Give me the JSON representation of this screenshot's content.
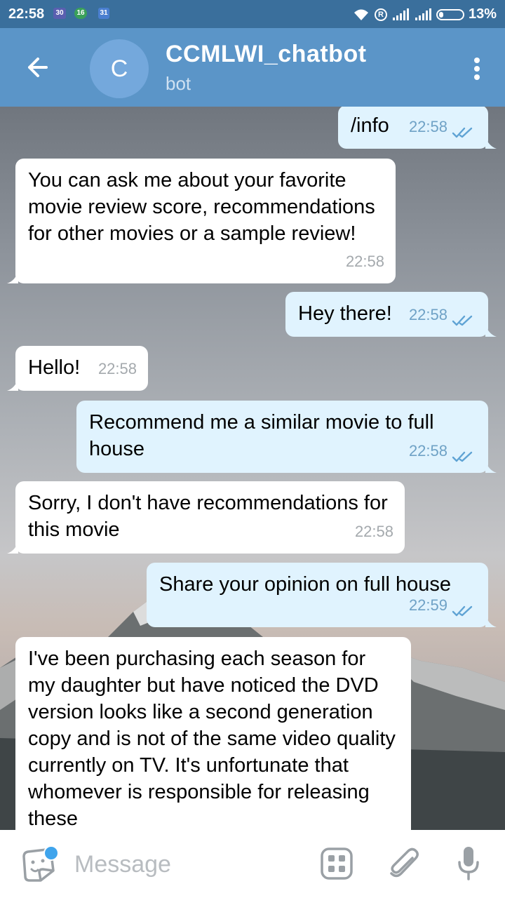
{
  "status_bar": {
    "time": "22:58",
    "badges": [
      "30",
      "16",
      "31"
    ],
    "registered_mark": "R",
    "battery": "13%"
  },
  "header": {
    "avatar_letter": "C",
    "title": "CCMLWI_chatbot",
    "subtitle": "bot"
  },
  "messages": [
    {
      "direction": "out",
      "text": "/info",
      "time": "22:58",
      "read": true
    },
    {
      "direction": "in",
      "text": "You can ask me about your favorite movie review score, recommendations for other movies or a sample review!",
      "time": "22:58"
    },
    {
      "direction": "out",
      "text": "Hey there!",
      "time": "22:58",
      "read": true
    },
    {
      "direction": "in",
      "text": "Hello!",
      "time": "22:58"
    },
    {
      "direction": "out",
      "text": "Recommend me a similar movie to full house",
      "time": "22:58",
      "read": true
    },
    {
      "direction": "in",
      "text": "Sorry, I don't have recommendations for this movie",
      "time": "22:58"
    },
    {
      "direction": "out",
      "text": "Share your opinion on full house",
      "time": "22:59",
      "read": true
    },
    {
      "direction": "in",
      "text": "I've been purchasing each season for my daughter but have noticed the DVD version looks like a second generation copy and is not of the same video quality currently on TV. It's unfortunate that whomever is responsible for releasing these",
      "time": ""
    }
  ],
  "input_bar": {
    "placeholder": "Message"
  },
  "icons": {
    "back": "arrow-left-icon",
    "menu": "more-vertical-icon",
    "emoji": "sticker-icon",
    "bot_commands": "bot-keyboard-icon",
    "attach": "paperclip-icon",
    "mic": "microphone-icon",
    "read": "double-check-icon"
  },
  "colors": {
    "header": "#5b95c8",
    "status_bar": "#3a6f9c",
    "outgoing_bubble": "#e0f3fe",
    "incoming_bubble": "#ffffff"
  }
}
